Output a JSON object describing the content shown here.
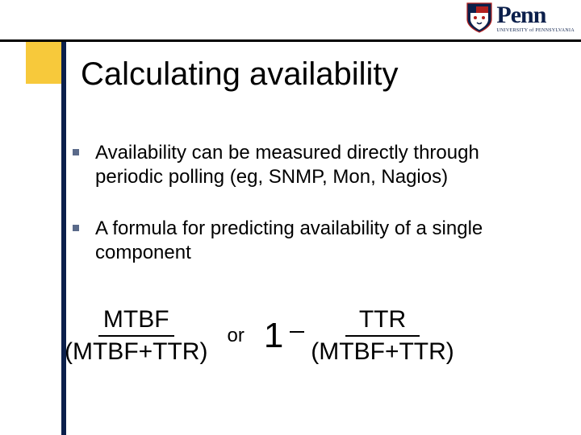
{
  "logo": {
    "word": "Penn",
    "subtitle": "UNIVERSITY of PENNSYLVANIA"
  },
  "title": "Calculating availability",
  "bullets": [
    "Availability can be measured directly through periodic polling (eg, SNMP, Mon, Nagios)",
    "A formula for predicting availability of a single component"
  ],
  "formula": {
    "left": {
      "numerator": "MTBF",
      "denominator": "(MTBF+TTR)"
    },
    "connector": "or",
    "right": {
      "one": "1",
      "numerator": "TTR",
      "denominator": "(MTBF+TTR)"
    }
  }
}
